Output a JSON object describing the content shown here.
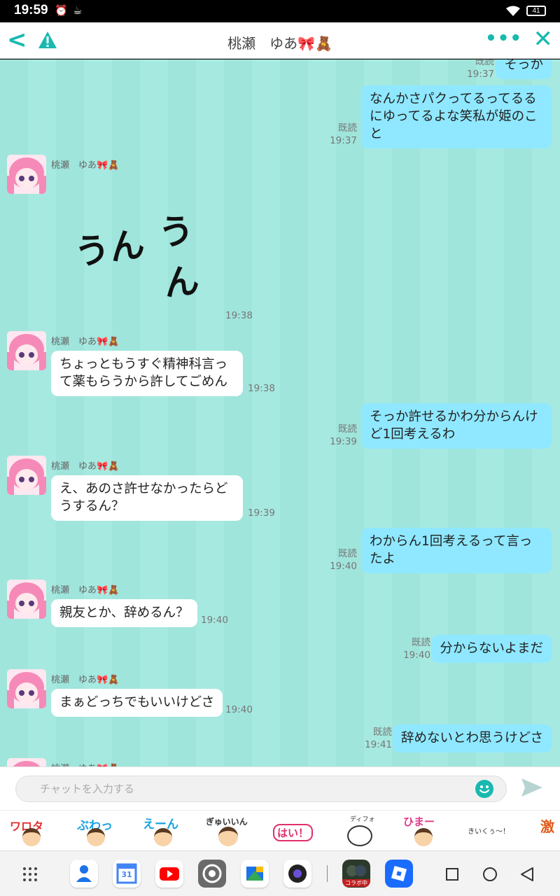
{
  "status_bar": {
    "time": "19:59",
    "battery": "41"
  },
  "header": {
    "title": "桃瀬　ゆあ🎀🧸"
  },
  "colors": {
    "accent": "#19b9b0",
    "my_bubble": "#8fe8ff",
    "chat_bg": "#a3e7de"
  },
  "messages": [
    {
      "side": "me",
      "text": "そっか",
      "status": "既読",
      "time": "19:37"
    },
    {
      "side": "me",
      "text": "なんかさパクってるってるるにゆってるよな笑私が姫のこと",
      "status": "既読",
      "time": "19:37"
    },
    {
      "side": "them",
      "sender": "桃瀬　ゆあ🎀🧸",
      "sticker": "うん うん",
      "time": "19:38"
    },
    {
      "side": "them",
      "sender": "桃瀬　ゆあ🎀🧸",
      "text": "ちょっともうすぐ精神科言って薬もらうから許してごめん",
      "time": "19:38"
    },
    {
      "side": "me",
      "text": "そっか許せるかわ分からんけど1回考えるわ",
      "status": "既読",
      "time": "19:39"
    },
    {
      "side": "them",
      "sender": "桃瀬　ゆあ🎀🧸",
      "text": "え、あのさ許せなかったらどうするん？",
      "time": "19:39"
    },
    {
      "side": "me",
      "text": "わからん1回考えるって言ったよ",
      "status": "既読",
      "time": "19:40"
    },
    {
      "side": "them",
      "sender": "桃瀬　ゆあ🎀🧸",
      "text": "親友とか、辞めるん？",
      "time": "19:40"
    },
    {
      "side": "me",
      "text": "分からないよまだ",
      "status": "既読",
      "time": "19:40"
    },
    {
      "side": "them",
      "sender": "桃瀬　ゆあ🎀🧸",
      "text": "まぁどっちでもいいけどさ",
      "time": "19:40"
    },
    {
      "side": "me",
      "text": "辞めないとわ思うけどさ",
      "status": "既読",
      "time": "19:41"
    },
    {
      "side": "them",
      "sender": "桃瀬　ゆあ🎀🧸"
    }
  ],
  "sticker_lines": [
    "うん",
    "うん"
  ],
  "input": {
    "placeholder": "チャットを入力する"
  },
  "stickers": [
    {
      "label": "ワロタ"
    },
    {
      "label": "ぶわっ"
    },
    {
      "label": "えーん"
    },
    {
      "label": "ぎゅいいん"
    },
    {
      "label": "はい！"
    },
    {
      "label": "ディフォ"
    },
    {
      "label": "ひまー"
    },
    {
      "label": "きいくぅ〜！"
    },
    {
      "label": "激"
    }
  ],
  "dock": {
    "apps": [
      "contacts-app",
      "calendar-app",
      "youtube-app",
      "settings-app",
      "files-app",
      "camera-app",
      "game-app",
      "roblox-app"
    ],
    "calendar_day": "31",
    "game_label": "コラボ中"
  }
}
